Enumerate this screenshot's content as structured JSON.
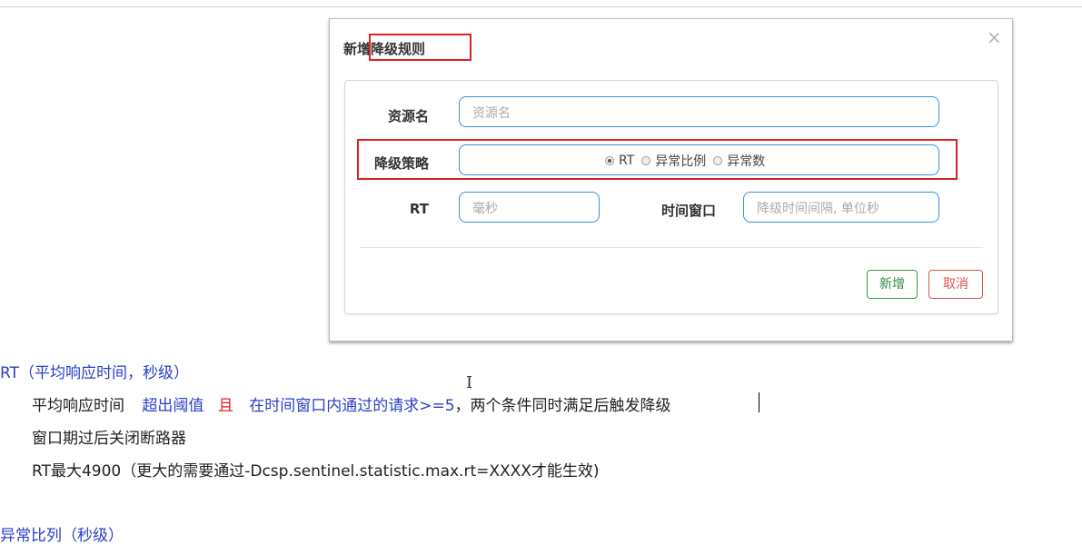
{
  "dialog": {
    "title": "新增降级规则",
    "close_glyph": "×",
    "resource": {
      "label": "资源名",
      "placeholder": "资源名"
    },
    "strategy": {
      "label": "降级策略",
      "options": [
        {
          "label": "RT",
          "checked": true
        },
        {
          "label": "异常比例",
          "checked": false
        },
        {
          "label": "异常数",
          "checked": false
        }
      ]
    },
    "rt": {
      "label": "RT",
      "placeholder": "毫秒"
    },
    "window": {
      "label": "时间窗口",
      "placeholder": "降级时间间隔, 单位秒"
    },
    "buttons": {
      "add": "新增",
      "cancel": "取消"
    }
  },
  "notes": {
    "rt_heading": "RT（平均响应时间，秒级）",
    "line1": {
      "part1": "平均响应时间",
      "part2": "超出阈值",
      "part3": "且",
      "part4": "在时间窗口内通过的请求>=5",
      "part5": "，两个条件同时满足后触发降级"
    },
    "line2": "窗口期过后关闭断路器",
    "line3": "RT最大4900（更大的需要通过-Dcsp.sentinel.statistic.max.rt=XXXX才能生效)",
    "ratio_heading": "异常比列（秒级）"
  },
  "colors": {
    "highlight": "#e02020",
    "input_border": "#3d8fd1",
    "heading_blue": "#2a40c8",
    "add_green": "#2e8b3e",
    "cancel_red": "#d9534f"
  }
}
